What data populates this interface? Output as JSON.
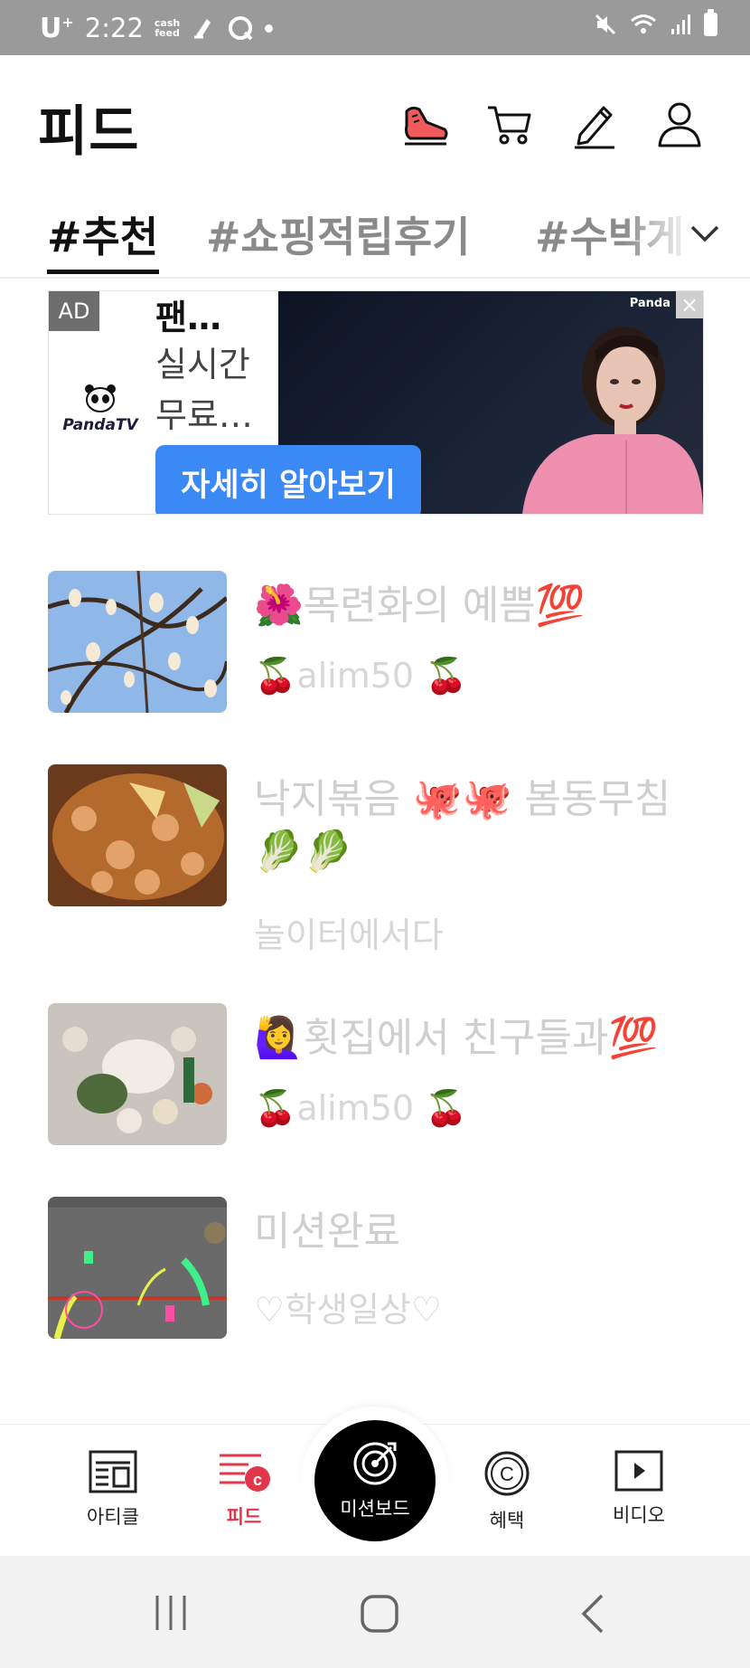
{
  "status_bar": {
    "carrier": "U",
    "carrier_sup": "+",
    "time": "2:22",
    "cashfeed": [
      "cash",
      "feed"
    ]
  },
  "header": {
    "title": "피드",
    "icons": [
      "sneaker-icon",
      "cart-icon",
      "pencil-icon",
      "profile-icon"
    ]
  },
  "tabs": {
    "items": [
      "#추천",
      "#쇼핑적립후기",
      "#수박게임"
    ],
    "active_index": 0
  },
  "ad": {
    "badge": "AD",
    "brand_logo": "PandaTV",
    "title": "팬…",
    "lines": [
      "실시간",
      "무료…"
    ],
    "cta": "자세히 알아보기",
    "image_brand": "Panda"
  },
  "feed": [
    {
      "title": "🌺목련화의 예쁨💯",
      "author": "🍒alim50 🍒"
    },
    {
      "title": "낙지볶음 🐙🐙 봄동무침🥬🥬",
      "author": "놀이터에서다"
    },
    {
      "title": "🙋‍♀️횟집에서 친구들과💯",
      "author": "🍒alim50 🍒"
    },
    {
      "title": "미션완료",
      "author": "♡학생일상♡"
    }
  ],
  "bottom_nav": {
    "items": [
      {
        "label": "아티클",
        "active": false
      },
      {
        "label": "피드",
        "active": true
      },
      {
        "label": "미션보드",
        "active": false
      },
      {
        "label": "혜택",
        "active": false
      },
      {
        "label": "비디오",
        "active": false
      }
    ]
  },
  "colors": {
    "accent": "#e2374a",
    "ad_cta": "#3b89f5",
    "status_bar": "#9a9a9a"
  }
}
